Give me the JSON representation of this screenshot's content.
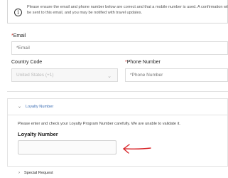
{
  "notice": {
    "text": "Please ensure the email and phone number below are correct and that a mobile number is used. A confirmation will be sent to this email, and you may be notified with travel updates."
  },
  "email": {
    "required_mark": "*",
    "label": "Email",
    "placeholder": "*Email"
  },
  "country_code": {
    "label": "Country Code",
    "value": "United States (+1)"
  },
  "phone": {
    "required_mark": "*",
    "label": "Phone Number",
    "placeholder": "*Phone Number"
  },
  "loyalty": {
    "toggle_label": "Loyalty Number",
    "help_text": "Please enter and check your Loyalty Program Number carefully. We are unable to validate it.",
    "field_label": "Loyalty Number",
    "value": ""
  },
  "special_request": {
    "toggle_label": "Special Request"
  },
  "colors": {
    "accent_link": "#3b6db3",
    "required": "#d0342c",
    "annotation_arrow": "#d8262a"
  }
}
